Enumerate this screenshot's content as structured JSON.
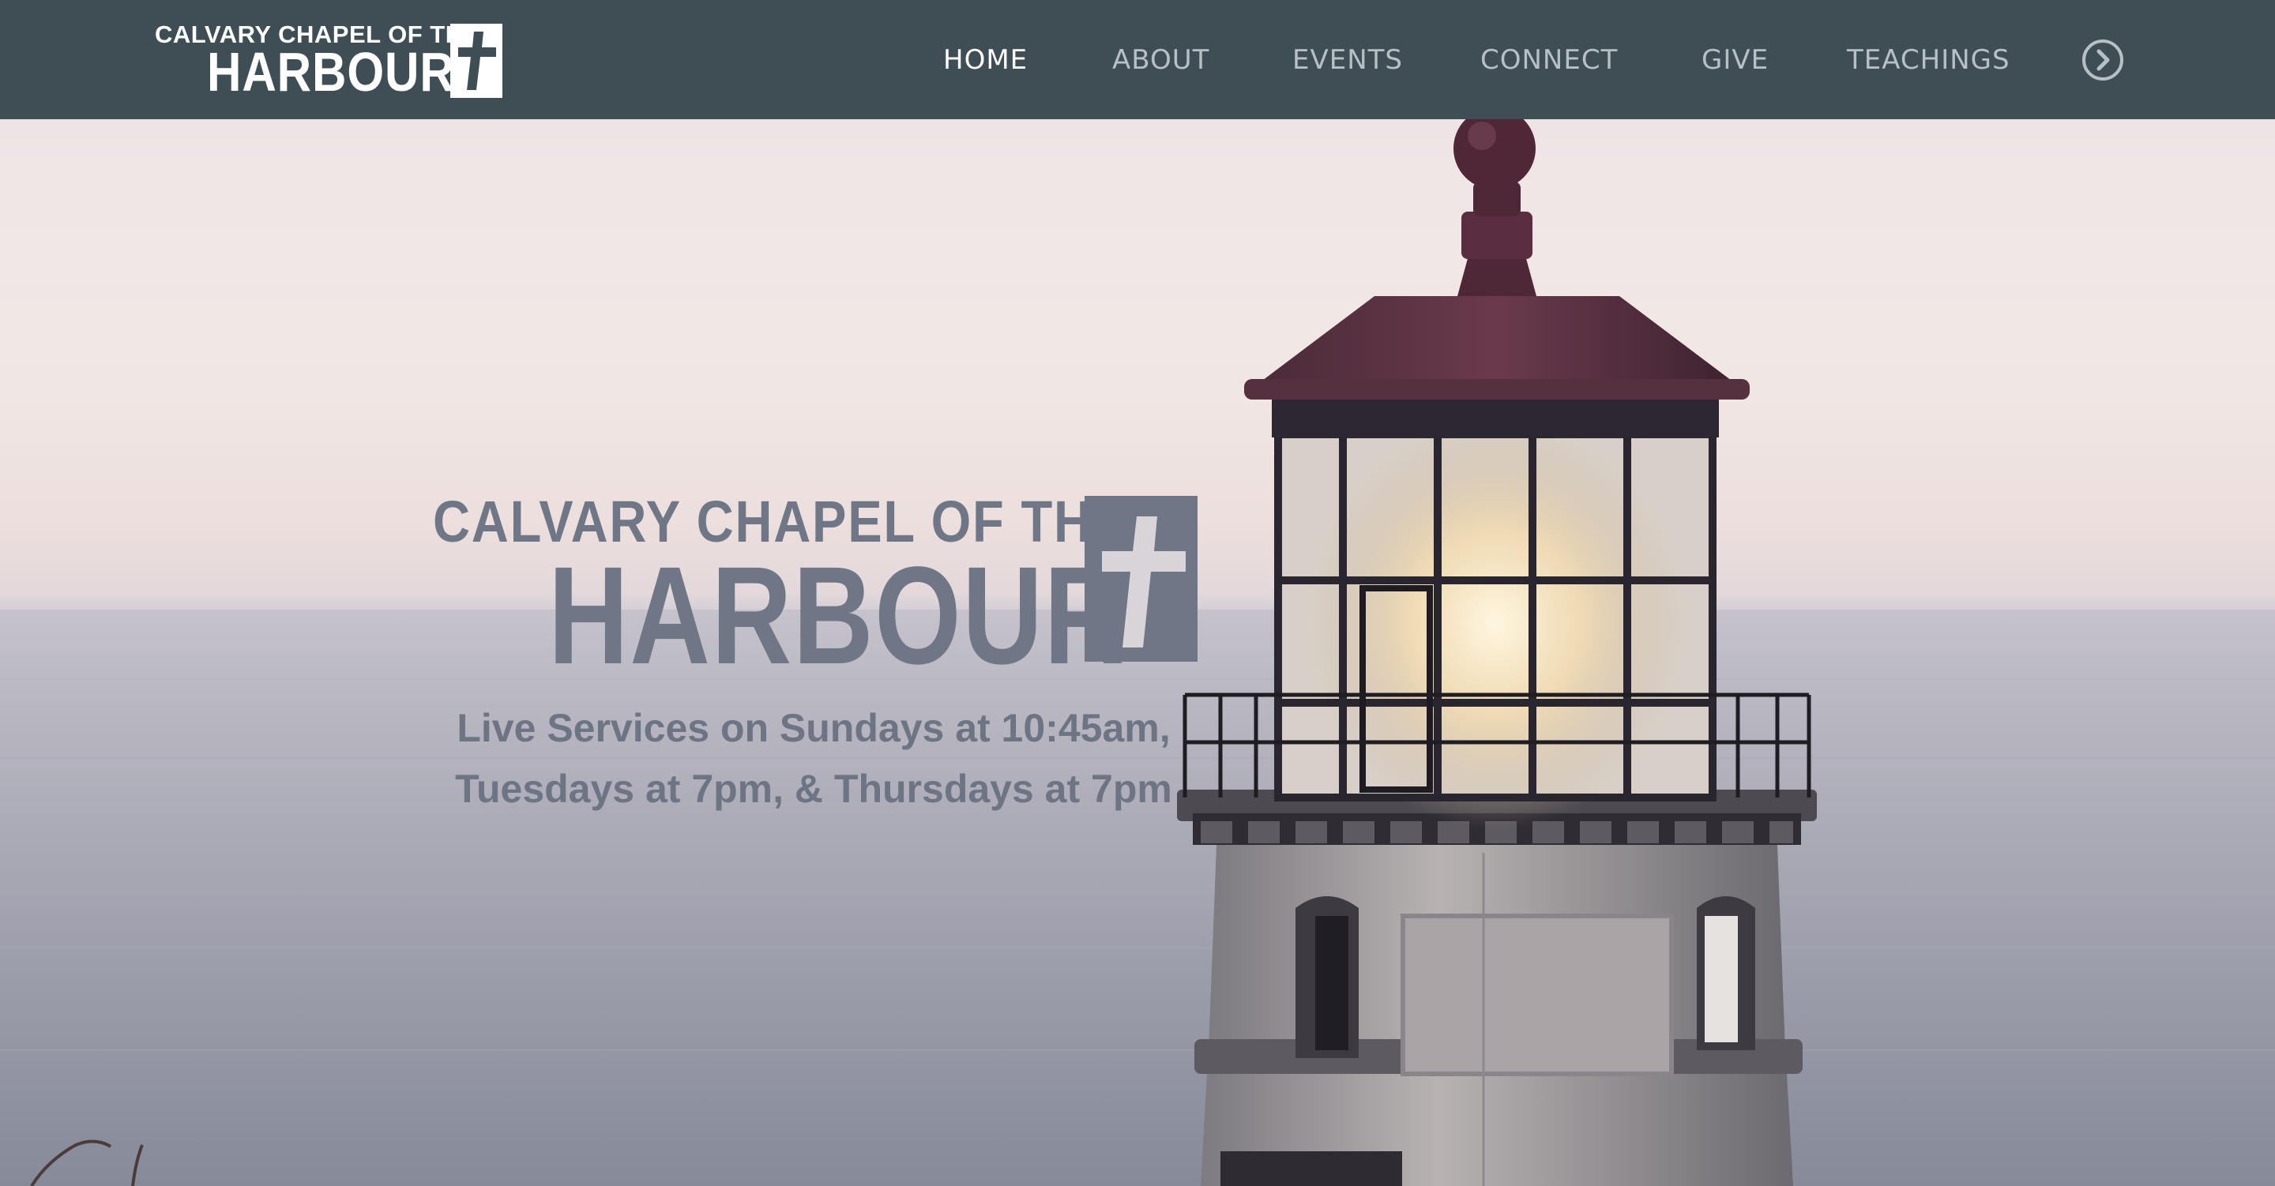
{
  "site": {
    "logo_line1": "CALVARY CHAPEL OF THE",
    "logo_line2": "HARBOUR"
  },
  "nav": {
    "items": [
      {
        "label": "HOME",
        "active": true
      },
      {
        "label": "ABOUT",
        "active": false
      },
      {
        "label": "EVENTS",
        "active": false
      },
      {
        "label": "CONNECT",
        "active": false
      },
      {
        "label": "GIVE",
        "active": false
      },
      {
        "label": "TEACHINGS",
        "active": false
      }
    ],
    "more_icon": "chevron-right-circle-icon"
  },
  "hero": {
    "logo_line1": "CALVARY CHAPEL OF THE",
    "logo_line2": "HARBOUR",
    "tagline_line1": "Live Services on Sundays at 10:45am,",
    "tagline_line2": "Tuesdays at 7pm, & Thursdays at 7pm",
    "background": "lighthouse-over-ocean-photo"
  },
  "colors": {
    "nav_bg": "#3f4e55",
    "nav_text": "#b7c0c4",
    "nav_active": "#ffffff",
    "hero_text": "#6f7787"
  }
}
